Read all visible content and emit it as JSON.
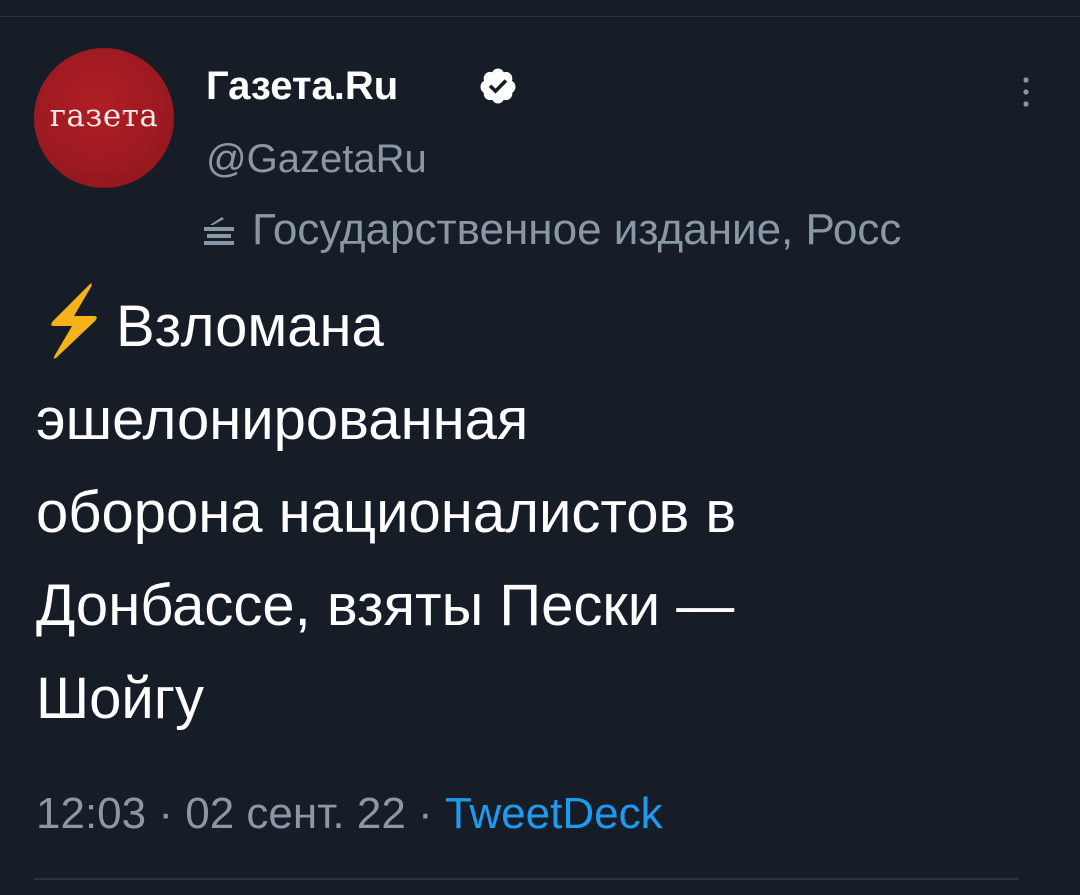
{
  "account": {
    "avatar_text": "газета",
    "display_name": "Газета.Ru",
    "handle": "@GazetaRu",
    "label": "Государственное издание, Росс"
  },
  "tweet": {
    "lines": [
      "Взломана",
      "эшелонированная",
      "оборона националистов в",
      "Донбассе, взяты Пески —",
      "Шойгу"
    ]
  },
  "meta": {
    "time": "12:03",
    "sep1": " · ",
    "date": "02 сент. 22",
    "sep2": " · ",
    "source": "TweetDeck"
  },
  "icons": {
    "verified": "verified-badge-icon",
    "more": "more-vertical-icon",
    "label": "podium-icon",
    "bolt": "lightning-bolt-emoji"
  },
  "colors": {
    "background": "#161d27",
    "secondary_text": "#8a98a6",
    "link": "#1d9bf0",
    "avatar": "#a81c22",
    "bolt": "#f7b21b"
  }
}
